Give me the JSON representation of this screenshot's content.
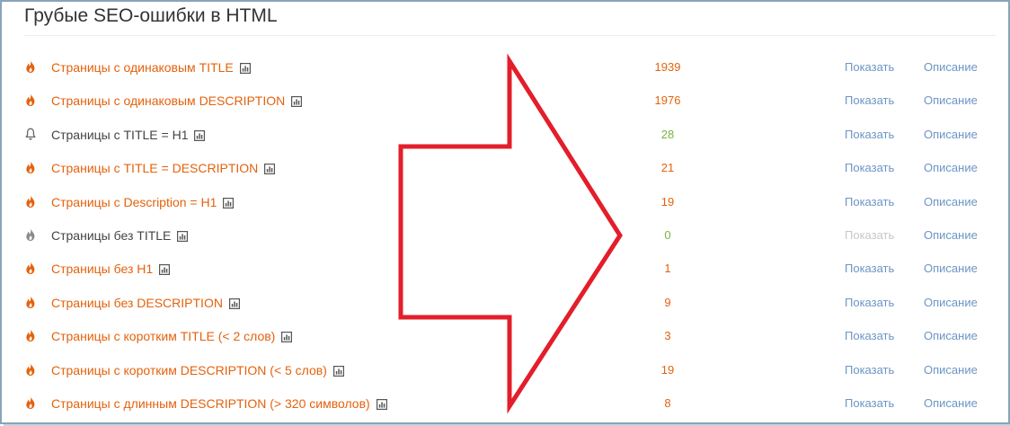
{
  "panel": {
    "title": "Грубые SEO-ошибки в HTML"
  },
  "colors": {
    "error": "#e4620d",
    "ok": "#7cb342",
    "link": "#6c95c4",
    "arrow": "#e31e2a"
  },
  "rows": [
    {
      "label": "Страницы с одинаковым TITLE",
      "count": "1939",
      "icon": "fire-icon",
      "severity": "error",
      "show": "Показать",
      "desc": "Описание",
      "show_enabled": true
    },
    {
      "label": "Страницы с одинаковым DESCRIPTION",
      "count": "1976",
      "icon": "fire-icon",
      "severity": "error",
      "show": "Показать",
      "desc": "Описание",
      "show_enabled": true
    },
    {
      "label": "Страницы с TITLE = H1",
      "count": "28",
      "icon": "bell-icon",
      "severity": "notice",
      "show": "Показать",
      "desc": "Описание",
      "show_enabled": true
    },
    {
      "label": "Страницы с TITLE = DESCRIPTION",
      "count": "21",
      "icon": "fire-icon",
      "severity": "error",
      "show": "Показать",
      "desc": "Описание",
      "show_enabled": true
    },
    {
      "label": "Страницы с Description = H1",
      "count": "19",
      "icon": "fire-icon",
      "severity": "error",
      "show": "Показать",
      "desc": "Описание",
      "show_enabled": true
    },
    {
      "label": "Страницы без TITLE",
      "count": "0",
      "icon": "fire-icon",
      "severity": "ok",
      "show": "Показать",
      "desc": "Описание",
      "show_enabled": false
    },
    {
      "label": "Страницы без H1",
      "count": "1",
      "icon": "fire-icon",
      "severity": "error",
      "show": "Показать",
      "desc": "Описание",
      "show_enabled": true
    },
    {
      "label": "Страницы без DESCRIPTION",
      "count": "9",
      "icon": "fire-icon",
      "severity": "error",
      "show": "Показать",
      "desc": "Описание",
      "show_enabled": true
    },
    {
      "label": "Страницы с коротким TITLE (< 2 слов)",
      "count": "3",
      "icon": "fire-icon",
      "severity": "error",
      "show": "Показать",
      "desc": "Описание",
      "show_enabled": true
    },
    {
      "label": "Страницы с коротким DESCRIPTION (< 5 слов)",
      "count": "19",
      "icon": "fire-icon",
      "severity": "error",
      "show": "Показать",
      "desc": "Описание",
      "show_enabled": true
    },
    {
      "label": "Страницы с длинным DESCRIPTION (> 320 символов)",
      "count": "8",
      "icon": "fire-icon",
      "severity": "error",
      "show": "Показать",
      "desc": "Описание",
      "show_enabled": true
    }
  ]
}
